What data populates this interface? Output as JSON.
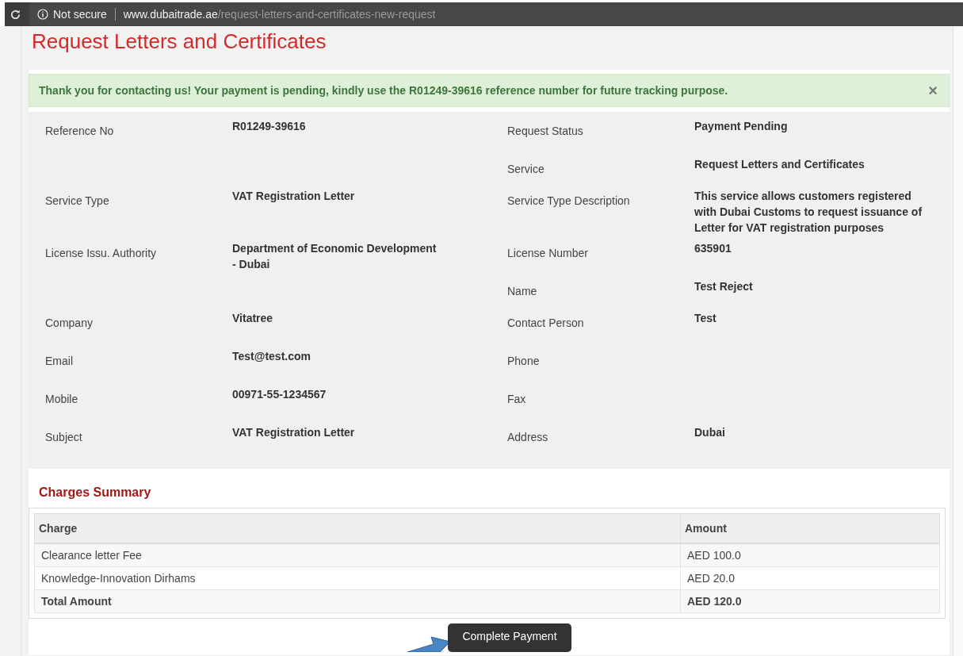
{
  "browser": {
    "security": "Not secure",
    "url_host": "www.dubaitrade.ae",
    "url_path": "/request-letters-and-certificates-new-request"
  },
  "page_title": "Request Letters and Certificates",
  "alert": {
    "message": "Thank you for contacting us! Your payment is pending, kindly use the R01249-39616 reference number for future tracking purpose.",
    "close": "×"
  },
  "details": [
    {
      "left": {
        "label": "Reference No",
        "value": "R01249-39616"
      },
      "right": {
        "label": "Request Status",
        "value": "Payment Pending"
      }
    },
    {
      "right": {
        "label": "Service",
        "value": "Request Letters and Certificates"
      }
    },
    {
      "left": {
        "label": "Service Type",
        "value": "VAT Registration Letter"
      },
      "right": {
        "label": "Service Type Description",
        "value": "This service allows customers registered with Dubai Customs to request issuance of Letter for VAT registration purposes"
      }
    },
    {
      "left": {
        "label": "License Issu. Authority",
        "value": "Department of Economic Development - Dubai"
      },
      "right": {
        "label": "License Number",
        "value": "635901"
      }
    },
    {
      "right": {
        "label": "Name",
        "value": "Test Reject"
      }
    },
    {
      "left": {
        "label": "Company",
        "value": "Vitatree"
      },
      "right": {
        "label": "Contact Person",
        "value": "Test"
      }
    },
    {
      "left": {
        "label": "Email",
        "value": "Test@test.com"
      },
      "right": {
        "label": "Phone"
      }
    },
    {
      "left": {
        "label": "Mobile",
        "value": "00971-55-1234567"
      },
      "right": {
        "label": "Fax"
      }
    },
    {
      "left": {
        "label": "Subject",
        "value": "VAT Registration Letter"
      },
      "right": {
        "label": "Address",
        "value": "Dubai"
      }
    }
  ],
  "charges": {
    "title": "Charges Summary",
    "columns": [
      "Charge",
      "Amount"
    ],
    "rows": [
      {
        "charge": "Clearance letter Fee",
        "amount": "AED 100.0",
        "total": false
      },
      {
        "charge": "Knowledge-Innovation Dirhams",
        "amount": "AED 20.0",
        "total": false
      },
      {
        "charge": "Total Amount",
        "amount": "AED 120.0",
        "total": true
      }
    ]
  },
  "button": "Complete Payment"
}
